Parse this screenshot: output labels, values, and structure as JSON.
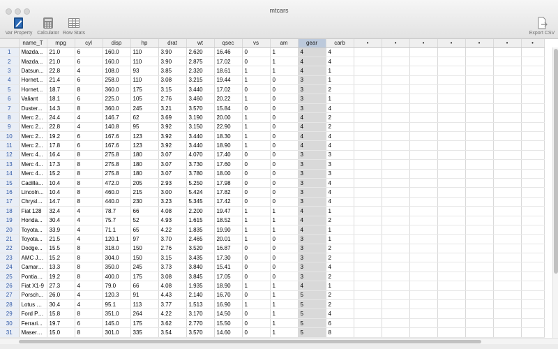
{
  "window": {
    "title": "mtcars"
  },
  "toolbar": {
    "var_property": "Var Property",
    "calculator": "Calculator",
    "row_stats": "Row Stats",
    "export_csv": "Export CSV"
  },
  "icons": {
    "var_property": "pencil-doc-icon",
    "calculator": "calculator-icon",
    "row_stats": "table-grid-icon",
    "export_csv": "export-doc-icon"
  },
  "selected_column": "gear",
  "columns": [
    "name_T",
    "mpg",
    "cyl",
    "disp",
    "hp",
    "drat",
    "wt",
    "qsec",
    "vs",
    "am",
    "gear",
    "carb",
    "•",
    "•",
    "•",
    "•",
    "•",
    "•",
    "•"
  ],
  "rows": [
    [
      "1",
      "Mazda...",
      "21.0",
      "6",
      "160.0",
      "110",
      "3.90",
      "2.620",
      "16.46",
      "0",
      "1",
      "4",
      "4"
    ],
    [
      "2",
      "Mazda...",
      "21.0",
      "6",
      "160.0",
      "110",
      "3.90",
      "2.875",
      "17.02",
      "0",
      "1",
      "4",
      "4"
    ],
    [
      "3",
      "Datsun...",
      "22.8",
      "4",
      "108.0",
      "93",
      "3.85",
      "2.320",
      "18.61",
      "1",
      "1",
      "4",
      "1"
    ],
    [
      "4",
      "Hornet...",
      "21.4",
      "6",
      "258.0",
      "110",
      "3.08",
      "3.215",
      "19.44",
      "1",
      "0",
      "3",
      "1"
    ],
    [
      "5",
      "Hornet...",
      "18.7",
      "8",
      "360.0",
      "175",
      "3.15",
      "3.440",
      "17.02",
      "0",
      "0",
      "3",
      "2"
    ],
    [
      "6",
      "Valiant",
      "18.1",
      "6",
      "225.0",
      "105",
      "2.76",
      "3.460",
      "20.22",
      "1",
      "0",
      "3",
      "1"
    ],
    [
      "7",
      "Duster...",
      "14.3",
      "8",
      "360.0",
      "245",
      "3.21",
      "3.570",
      "15.84",
      "0",
      "0",
      "3",
      "4"
    ],
    [
      "8",
      "Merc 2...",
      "24.4",
      "4",
      "146.7",
      "62",
      "3.69",
      "3.190",
      "20.00",
      "1",
      "0",
      "4",
      "2"
    ],
    [
      "9",
      "Merc 2...",
      "22.8",
      "4",
      "140.8",
      "95",
      "3.92",
      "3.150",
      "22.90",
      "1",
      "0",
      "4",
      "2"
    ],
    [
      "10",
      "Merc 2...",
      "19.2",
      "6",
      "167.6",
      "123",
      "3.92",
      "3.440",
      "18.30",
      "1",
      "0",
      "4",
      "4"
    ],
    [
      "11",
      "Merc 2...",
      "17.8",
      "6",
      "167.6",
      "123",
      "3.92",
      "3.440",
      "18.90",
      "1",
      "0",
      "4",
      "4"
    ],
    [
      "12",
      "Merc 4...",
      "16.4",
      "8",
      "275.8",
      "180",
      "3.07",
      "4.070",
      "17.40",
      "0",
      "0",
      "3",
      "3"
    ],
    [
      "13",
      "Merc 4...",
      "17.3",
      "8",
      "275.8",
      "180",
      "3.07",
      "3.730",
      "17.60",
      "0",
      "0",
      "3",
      "3"
    ],
    [
      "14",
      "Merc 4...",
      "15.2",
      "8",
      "275.8",
      "180",
      "3.07",
      "3.780",
      "18.00",
      "0",
      "0",
      "3",
      "3"
    ],
    [
      "15",
      "Cadilla...",
      "10.4",
      "8",
      "472.0",
      "205",
      "2.93",
      "5.250",
      "17.98",
      "0",
      "0",
      "3",
      "4"
    ],
    [
      "16",
      "Lincoln...",
      "10.4",
      "8",
      "460.0",
      "215",
      "3.00",
      "5.424",
      "17.82",
      "0",
      "0",
      "3",
      "4"
    ],
    [
      "17",
      "Chrysle...",
      "14.7",
      "8",
      "440.0",
      "230",
      "3.23",
      "5.345",
      "17.42",
      "0",
      "0",
      "3",
      "4"
    ],
    [
      "18",
      "Fiat 128",
      "32.4",
      "4",
      "78.7",
      "66",
      "4.08",
      "2.200",
      "19.47",
      "1",
      "1",
      "4",
      "1"
    ],
    [
      "19",
      "Honda...",
      "30.4",
      "4",
      "75.7",
      "52",
      "4.93",
      "1.615",
      "18.52",
      "1",
      "1",
      "4",
      "2"
    ],
    [
      "20",
      "Toyota...",
      "33.9",
      "4",
      "71.1",
      "65",
      "4.22",
      "1.835",
      "19.90",
      "1",
      "1",
      "4",
      "1"
    ],
    [
      "21",
      "Toyota...",
      "21.5",
      "4",
      "120.1",
      "97",
      "3.70",
      "2.465",
      "20.01",
      "1",
      "0",
      "3",
      "1"
    ],
    [
      "22",
      "Dodge...",
      "15.5",
      "8",
      "318.0",
      "150",
      "2.76",
      "3.520",
      "16.87",
      "0",
      "0",
      "3",
      "2"
    ],
    [
      "23",
      "AMC Ja...",
      "15.2",
      "8",
      "304.0",
      "150",
      "3.15",
      "3.435",
      "17.30",
      "0",
      "0",
      "3",
      "2"
    ],
    [
      "24",
      "Camaro...",
      "13.3",
      "8",
      "350.0",
      "245",
      "3.73",
      "3.840",
      "15.41",
      "0",
      "0",
      "3",
      "4"
    ],
    [
      "25",
      "Pontiac...",
      "19.2",
      "8",
      "400.0",
      "175",
      "3.08",
      "3.845",
      "17.05",
      "0",
      "0",
      "3",
      "2"
    ],
    [
      "26",
      "Fiat X1-9",
      "27.3",
      "4",
      "79.0",
      "66",
      "4.08",
      "1.935",
      "18.90",
      "1",
      "1",
      "4",
      "1"
    ],
    [
      "27",
      "Porsch...",
      "26.0",
      "4",
      "120.3",
      "91",
      "4.43",
      "2.140",
      "16.70",
      "0",
      "1",
      "5",
      "2"
    ],
    [
      "28",
      "Lotus E...",
      "30.4",
      "4",
      "95.1",
      "113",
      "3.77",
      "1.513",
      "16.90",
      "1",
      "1",
      "5",
      "2"
    ],
    [
      "29",
      "Ford Pa...",
      "15.8",
      "8",
      "351.0",
      "264",
      "4.22",
      "3.170",
      "14.50",
      "0",
      "1",
      "5",
      "4"
    ],
    [
      "30",
      "Ferrari...",
      "19.7",
      "6",
      "145.0",
      "175",
      "3.62",
      "2.770",
      "15.50",
      "0",
      "1",
      "5",
      "6"
    ],
    [
      "31",
      "Masera...",
      "15.0",
      "8",
      "301.0",
      "335",
      "3.54",
      "3.570",
      "14.60",
      "0",
      "1",
      "5",
      "8"
    ]
  ]
}
